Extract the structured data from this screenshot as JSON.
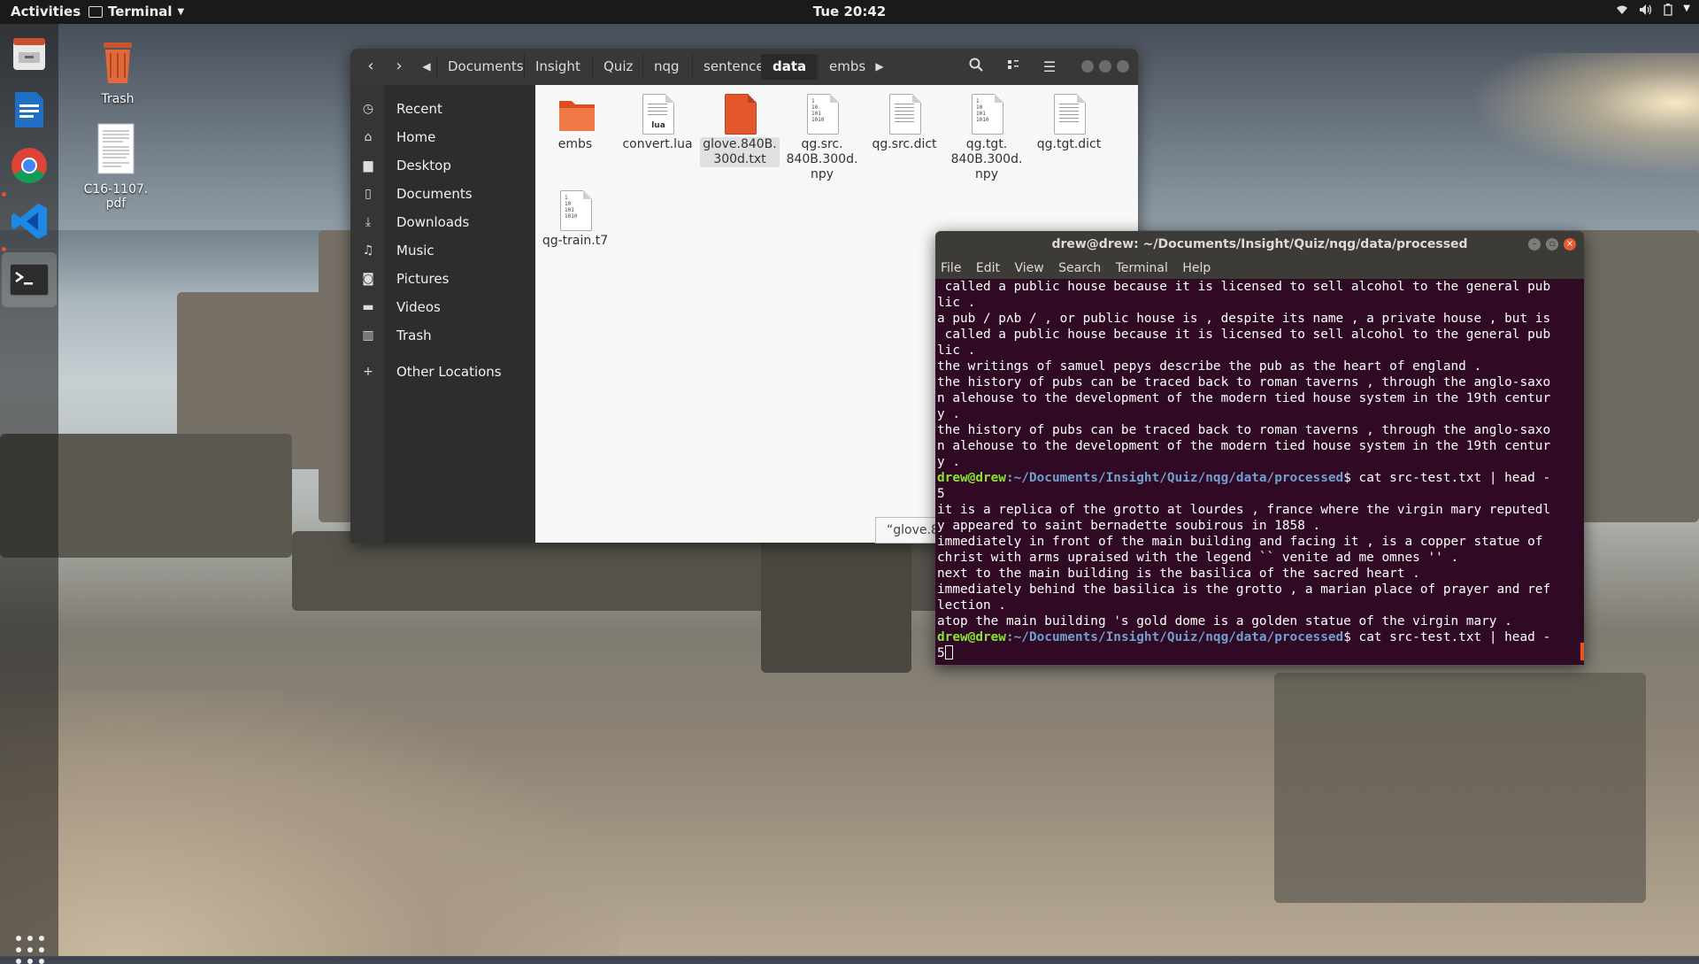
{
  "topbar": {
    "activities": "Activities",
    "app_name": "Terminal",
    "clock": "Tue 20:42"
  },
  "desktop": {
    "trash_label": "Trash",
    "pdf_label": "C16-1107.\npdf",
    "pdf_label_line1": "C16-1107.",
    "pdf_label_line2": "pdf"
  },
  "file_manager": {
    "breadcrumbs": [
      "Documents",
      "Insight",
      "Quiz",
      "nqg",
      "sentence",
      "data",
      "embs"
    ],
    "current_crumb": "data",
    "sidebar": [
      {
        "label": "Recent",
        "icon": "clock-icon"
      },
      {
        "label": "Home",
        "icon": "home-icon"
      },
      {
        "label": "Desktop",
        "icon": "folder-icon"
      },
      {
        "label": "Documents",
        "icon": "document-icon"
      },
      {
        "label": "Downloads",
        "icon": "download-icon"
      },
      {
        "label": "Music",
        "icon": "music-icon"
      },
      {
        "label": "Pictures",
        "icon": "camera-icon"
      },
      {
        "label": "Videos",
        "icon": "video-icon"
      },
      {
        "label": "Trash",
        "icon": "trash-icon"
      },
      {
        "label": "Other Locations",
        "icon": "plus-icon"
      }
    ],
    "files": [
      {
        "name_lines": [
          "embs"
        ],
        "type": "folder"
      },
      {
        "name_lines": [
          "convert.lua"
        ],
        "type": "lua"
      },
      {
        "name_lines": [
          "glove.840B.",
          "300d.txt"
        ],
        "type": "text-selected"
      },
      {
        "name_lines": [
          "qg.src.",
          "840B.300d.",
          "npy"
        ],
        "type": "binary"
      },
      {
        "name_lines": [
          "qg.src.dict"
        ],
        "type": "text"
      },
      {
        "name_lines": [
          "qg.tgt.",
          "840B.300d.",
          "npy"
        ],
        "type": "binary"
      },
      {
        "name_lines": [
          "qg.tgt.dict"
        ],
        "type": "text"
      },
      {
        "name_lines": [
          "qg-train.t7"
        ],
        "type": "binary"
      }
    ],
    "tooltip": "“glove.8"
  },
  "terminal": {
    "title": "drew@drew: ~/Documents/Insight/Quiz/nqg/data/processed",
    "menu": [
      "File",
      "Edit",
      "View",
      "Search",
      "Terminal",
      "Help"
    ],
    "prompt_user": "drew@drew",
    "prompt_path": ":~/Documents/Insight/Quiz/nqg/data/processed",
    "command": "$ cat src-test.txt | head -",
    "lines_before": [
      " called a public house because it is licensed to sell alcohol to the general pub",
      "lic .",
      "a pub / pʌb / , or public house is , despite its name , a private house , but is",
      " called a public house because it is licensed to sell alcohol to the general pub",
      "lic .",
      "the writings of samuel pepys describe the pub as the heart of england .",
      "the history of pubs can be traced back to roman taverns , through the anglo-saxo",
      "n alehouse to the development of the modern tied house system in the 19th centur",
      "y .",
      "the history of pubs can be traced back to roman taverns , through the anglo-saxo",
      "n alehouse to the development of the modern tied house system in the 19th centur",
      "y ."
    ],
    "cont_1": "5",
    "lines_after": [
      "it is a replica of the grotto at lourdes , france where the virgin mary reputedl",
      "y appeared to saint bernadette soubirous in 1858 .",
      "immediately in front of the main building and facing it , is a copper statue of",
      "christ with arms upraised with the legend `` venite ad me omnes '' .",
      "next to the main building is the basilica of the sacred heart .",
      "immediately behind the basilica is the grotto , a marian place of prayer and ref",
      "lection .",
      "atop the main building 's gold dome is a golden statue of the virgin mary ."
    ],
    "cont_2": "5"
  },
  "colors": {
    "terminal_bg": "#300a24",
    "prompt_user": "#8ae234",
    "prompt_path": "#729fcf",
    "accent": "#e95420"
  }
}
